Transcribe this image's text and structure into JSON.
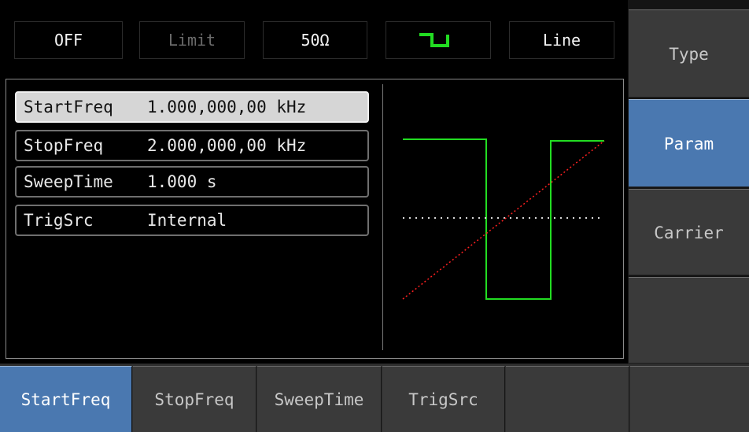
{
  "status_bar": {
    "output": "OFF",
    "limit": "Limit",
    "load": "50Ω",
    "waveform_icon": "square-wave-icon",
    "sweep_mode": "Line"
  },
  "params": [
    {
      "name": "StartFreq",
      "value": "1.000,000,00 kHz",
      "selected": true
    },
    {
      "name": "StopFreq",
      "value": "2.000,000,00 kHz",
      "selected": false
    },
    {
      "name": "SweepTime",
      "value": "1.000 s",
      "selected": false
    },
    {
      "name": "TrigSrc",
      "value": "Internal",
      "selected": false
    }
  ],
  "softkeys_right": [
    {
      "label": "Type",
      "active": false
    },
    {
      "label": "Param",
      "active": true
    },
    {
      "label": "Carrier",
      "active": false
    },
    {
      "label": "",
      "active": false
    }
  ],
  "softkeys_bottom": [
    {
      "label": "StartFreq",
      "active": true
    },
    {
      "label": "StopFreq",
      "active": false
    },
    {
      "label": "SweepTime",
      "active": false
    },
    {
      "label": "TrigSrc",
      "active": false
    },
    {
      "label": "",
      "active": false
    },
    {
      "label": "",
      "active": false
    }
  ],
  "colors": {
    "waveform": "#22dd22",
    "sweep_ramp": "#ff2020",
    "midline": "#d8d8d8",
    "active_key": "#4a78b0"
  }
}
